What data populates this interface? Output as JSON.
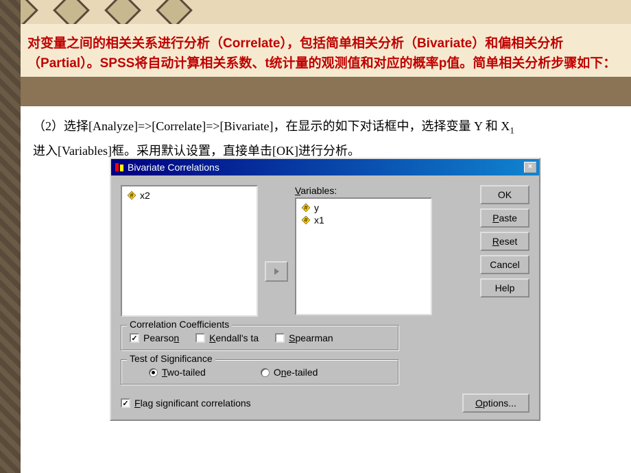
{
  "intro": {
    "line1_pre": "对变量之间的相关关系进行分析（",
    "correlate": "Correlate",
    "line1_mid": "），包括简单相关分析（",
    "bivariate": "Bivariate",
    "line1_end": "）和偏相关分析（",
    "partial": "Partial",
    "line2_pre": "）。",
    "spss": "SPSS",
    "line2_mid": "将自动计算相关系数、",
    "t": "t",
    "line2_end": "统计量的观测值和对应的概率",
    "p": "p",
    "line2_final": "值。简单相关分析步骤如下："
  },
  "instruction": {
    "num": "（2）",
    "text1": "选择[Analyze]=>[Correlate]=>[Bivariate]，在显示的如下对话框中，选择变量 Y 和 X",
    "sub1": "1",
    "text2": "进入[Variables]框。采用默认设置，直接单击[OK]进行分析。"
  },
  "dialog": {
    "title": "Bivariate Correlations",
    "close": "×",
    "left_items": [
      "x2"
    ],
    "variables_label_u": "V",
    "variables_label_rest": "ariables:",
    "right_items": [
      "y",
      "x1"
    ],
    "buttons": {
      "ok": "OK",
      "paste_u": "P",
      "paste_rest": "aste",
      "reset_u": "R",
      "reset_rest": "eset",
      "cancel": "Cancel",
      "help": "Help",
      "options_u": "O",
      "options_rest": "ptions..."
    },
    "cc": {
      "legend": "Correlation Coefficients",
      "pearson_pre": "Pearso",
      "pearson_u": "n",
      "kendall_u": "K",
      "kendall_rest": "endall's ta",
      "spearman_u": "S",
      "spearman_rest": "pearman",
      "pearson_checked": true,
      "kendall_checked": false,
      "spearman_checked": false
    },
    "ts": {
      "legend": "Test of Significance",
      "two_u": "T",
      "two_rest": "wo-tailed",
      "one_pre": "O",
      "one_u": "n",
      "one_rest": "e-tailed",
      "two_selected": true
    },
    "flag_u": "F",
    "flag_rest": "lag significant correlations",
    "flag_checked": true
  }
}
